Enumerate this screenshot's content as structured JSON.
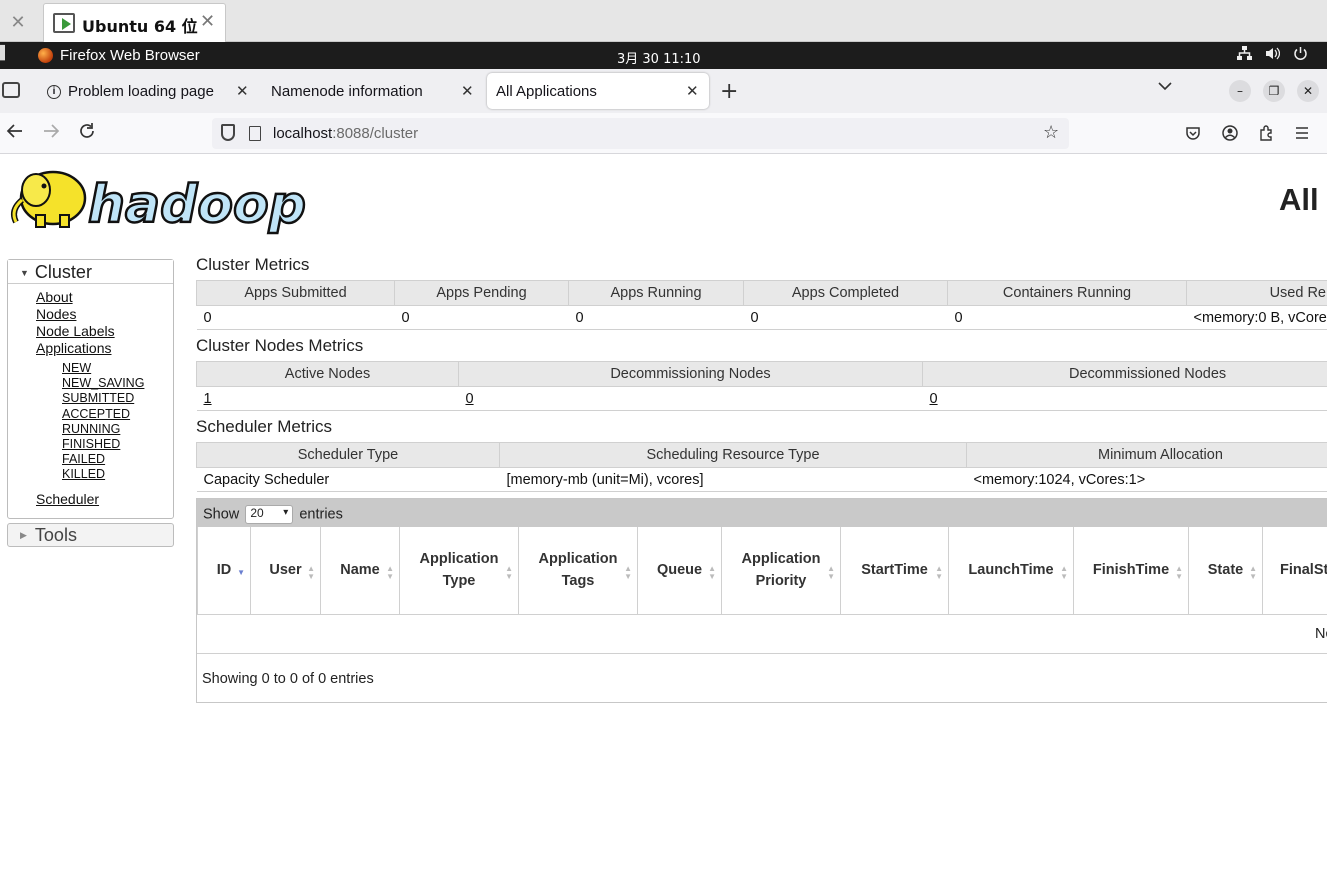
{
  "vm": {
    "tab_title": "Ubuntu 64 位"
  },
  "gnome": {
    "activities": "▌",
    "app_name": "Firefox Web Browser",
    "clock": "3月 30  11:10"
  },
  "browser": {
    "tabs": [
      {
        "label": "Problem loading page"
      },
      {
        "label": "Namenode information"
      },
      {
        "label": "All Applications"
      }
    ],
    "url_host": "localhost",
    "url_rest": ":8088/cluster"
  },
  "page": {
    "title": "All",
    "sidebar": {
      "cluster_heading": "Cluster",
      "links": [
        "About",
        "Nodes",
        "Node Labels",
        "Applications"
      ],
      "states": [
        "NEW",
        "NEW_SAVING",
        "SUBMITTED",
        "ACCEPTED",
        "RUNNING",
        "FINISHED",
        "FAILED",
        "KILLED"
      ],
      "scheduler_link": "Scheduler",
      "tools_heading": "Tools"
    },
    "cluster_metrics": {
      "heading": "Cluster Metrics",
      "headers": [
        "Apps Submitted",
        "Apps Pending",
        "Apps Running",
        "Apps Completed",
        "Containers Running",
        "Used Re"
      ],
      "values": [
        "0",
        "0",
        "0",
        "0",
        "0",
        "<memory:0 B, vCore"
      ]
    },
    "node_metrics": {
      "heading": "Cluster Nodes Metrics",
      "headers": [
        "Active Nodes",
        "Decommissioning Nodes",
        "Decommissioned Nodes"
      ],
      "values": [
        "1",
        "0",
        "0"
      ]
    },
    "scheduler_metrics": {
      "heading": "Scheduler Metrics",
      "headers": [
        "Scheduler Type",
        "Scheduling Resource Type",
        "Minimum Allocation"
      ],
      "values": [
        "Capacity Scheduler",
        "[memory-mb (unit=Mi), vcores]",
        "<memory:1024, vCores:1>"
      ]
    },
    "apps_table": {
      "show_label": "Show",
      "page_size": "20",
      "entries_label": "entries",
      "columns": [
        {
          "l1": "ID",
          "l2": ""
        },
        {
          "l1": "User",
          "l2": ""
        },
        {
          "l1": "Name",
          "l2": ""
        },
        {
          "l1": "Application",
          "l2": "Type"
        },
        {
          "l1": "Application",
          "l2": "Tags"
        },
        {
          "l1": "Queue",
          "l2": ""
        },
        {
          "l1": "Application",
          "l2": "Priority"
        },
        {
          "l1": "StartTime",
          "l2": ""
        },
        {
          "l1": "LaunchTime",
          "l2": ""
        },
        {
          "l1": "FinishTime",
          "l2": ""
        },
        {
          "l1": "State",
          "l2": ""
        },
        {
          "l1": "FinalSt",
          "l2": ""
        }
      ],
      "empty_text": "No",
      "info": "Showing 0 to 0 of 0 entries"
    }
  }
}
